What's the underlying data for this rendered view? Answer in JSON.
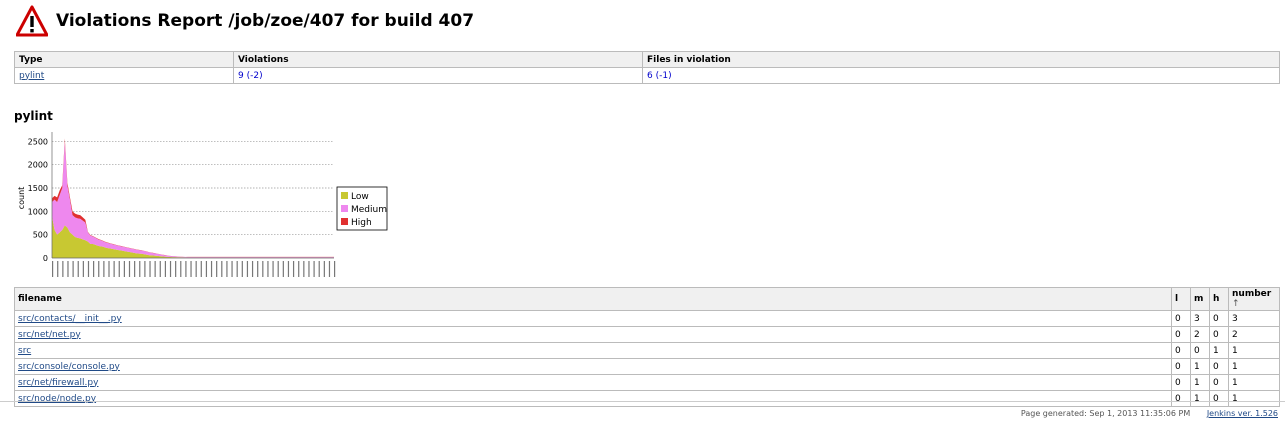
{
  "page": {
    "title": "Violations Report /job/zoe/407 for build 407",
    "icon": "warning-icon"
  },
  "summary": {
    "headers": [
      "Type",
      "Violations",
      "Files in violation"
    ],
    "rows": [
      {
        "type": "pylint",
        "violations": "9 (-2)",
        "files": "6 (-1)"
      }
    ]
  },
  "section": {
    "title": "pylint"
  },
  "chart_data": {
    "type": "area",
    "ylabel": "count",
    "yticks": [
      0,
      500,
      1000,
      1500,
      2000,
      2500
    ],
    "ylim": [
      0,
      2700
    ],
    "grid": true,
    "legend_position": "right",
    "series": [
      {
        "name": "Low",
        "color": "#c8c832",
        "values": [
          900,
          600,
          500,
          550,
          600,
          700,
          650,
          550,
          500,
          450,
          430,
          420,
          400,
          380,
          350,
          300,
          300,
          280,
          260,
          250,
          240,
          220,
          210,
          200,
          190,
          180,
          170,
          160,
          150,
          140,
          130,
          120,
          110,
          100,
          95,
          90,
          80,
          70,
          60,
          55,
          50,
          45,
          40,
          35,
          30,
          25,
          22,
          20,
          18,
          16,
          15,
          14,
          13,
          12,
          12,
          12,
          12,
          12,
          12,
          12,
          12,
          12,
          12,
          12,
          12,
          12,
          12,
          12,
          12,
          12,
          12,
          12,
          12,
          12,
          12,
          12,
          12,
          12,
          12,
          12,
          12,
          12,
          12,
          12,
          12,
          12,
          12,
          12,
          12,
          12,
          12,
          12,
          12,
          12,
          12,
          12,
          12,
          12,
          12,
          12,
          12,
          12,
          12,
          12,
          12,
          12,
          12,
          12,
          12,
          12,
          12
        ]
      },
      {
        "name": "Medium",
        "color": "#ee88ee",
        "values": [
          300,
          650,
          700,
          800,
          900,
          1800,
          900,
          700,
          420,
          420,
          420,
          420,
          400,
          380,
          200,
          180,
          160,
          150,
          140,
          130,
          120,
          115,
          110,
          105,
          100,
          95,
          92,
          90,
          88,
          86,
          84,
          82,
          80,
          78,
          75,
          72,
          70,
          65,
          60,
          55,
          50,
          45,
          40,
          35,
          30,
          25,
          20,
          18,
          16,
          14,
          12,
          10,
          10,
          10,
          10,
          10,
          10,
          10,
          10,
          10,
          10,
          10,
          10,
          10,
          10,
          10,
          10,
          10,
          10,
          10,
          10,
          10,
          10,
          10,
          10,
          10,
          10,
          10,
          10,
          10,
          10,
          10,
          10,
          10,
          10,
          10,
          10,
          10,
          10,
          10,
          10,
          10,
          10,
          10,
          10,
          10,
          10,
          10,
          10,
          10,
          10,
          10,
          10,
          10,
          10,
          10,
          10,
          10,
          10,
          10,
          10
        ]
      },
      {
        "name": "High",
        "color": "#e03030",
        "values": [
          80,
          80,
          100,
          100,
          60,
          60,
          60,
          50,
          80,
          80,
          80,
          80,
          70,
          60,
          10,
          10,
          10,
          10,
          10,
          8,
          8,
          8,
          8,
          6,
          6,
          6,
          6,
          6,
          5,
          5,
          5,
          5,
          5,
          5,
          5,
          5,
          4,
          4,
          4,
          4,
          4,
          4,
          3,
          3,
          3,
          3,
          3,
          3,
          3,
          3,
          2,
          2,
          2,
          2,
          2,
          2,
          2,
          2,
          2,
          2,
          2,
          2,
          2,
          2,
          2,
          2,
          2,
          2,
          2,
          2,
          2,
          2,
          2,
          2,
          2,
          2,
          2,
          2,
          2,
          2,
          2,
          2,
          2,
          2,
          2,
          2,
          2,
          2,
          2,
          2,
          2,
          2,
          2,
          2,
          2,
          2,
          2,
          2,
          2,
          2,
          2,
          2,
          2,
          2,
          2,
          2,
          2,
          2,
          2,
          2,
          2
        ]
      }
    ]
  },
  "files": {
    "headers": {
      "filename": "filename",
      "l": "l",
      "m": "m",
      "h": "h",
      "number": "number",
      "sort_arrow": "↑"
    },
    "rows": [
      {
        "filename": "src/contacts/__init__.py",
        "l": "0",
        "m": "3",
        "h": "0",
        "number": "3"
      },
      {
        "filename": "src/net/net.py",
        "l": "0",
        "m": "2",
        "h": "0",
        "number": "2"
      },
      {
        "filename": "src",
        "l": "0",
        "m": "0",
        "h": "1",
        "number": "1"
      },
      {
        "filename": "src/console/console.py",
        "l": "0",
        "m": "1",
        "h": "0",
        "number": "1"
      },
      {
        "filename": "src/net/firewall.py",
        "l": "0",
        "m": "1",
        "h": "0",
        "number": "1"
      },
      {
        "filename": "src/node/node.py",
        "l": "0",
        "m": "1",
        "h": "0",
        "number": "1"
      }
    ]
  },
  "footer": {
    "generated": "Page generated: Sep 1, 2013 11:35:06 PM",
    "version_link": "Jenkins ver. 1.526"
  }
}
